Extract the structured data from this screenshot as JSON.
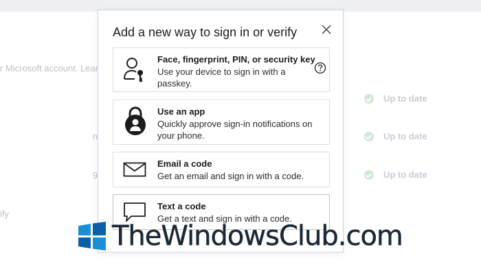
{
  "background": {
    "account_text": "r Microsoft account. Lear",
    "row_fragments": [
      "n",
      "9"
    ],
    "left_fragment": "ify",
    "status_items": [
      "Up to date",
      "Up to date",
      "Up to date"
    ]
  },
  "dialog": {
    "title": "Add a new way to sign in or verify",
    "options": [
      {
        "title": "Face, fingerprint, PIN, or security key",
        "desc": "Use your device to sign in with a passkey.",
        "icon": "passkey-icon",
        "has_help": true
      },
      {
        "title": "Use an app",
        "desc": "Quickly approve sign-in notifications on your phone.",
        "icon": "authenticator-lock-icon"
      },
      {
        "title": "Email a code",
        "desc": "Get an email and sign in with a code.",
        "icon": "envelope-icon"
      },
      {
        "title": "Text a code",
        "desc": "Get a text and sign in with a code.",
        "icon": "speech-bubble-icon"
      }
    ]
  },
  "watermark": {
    "text": "TheWindowsClub.com"
  },
  "colors": {
    "dialog_border": "#c8d2ea",
    "logo_blue": "#1a8fd8",
    "logo_dark": "#0b5fa5"
  }
}
